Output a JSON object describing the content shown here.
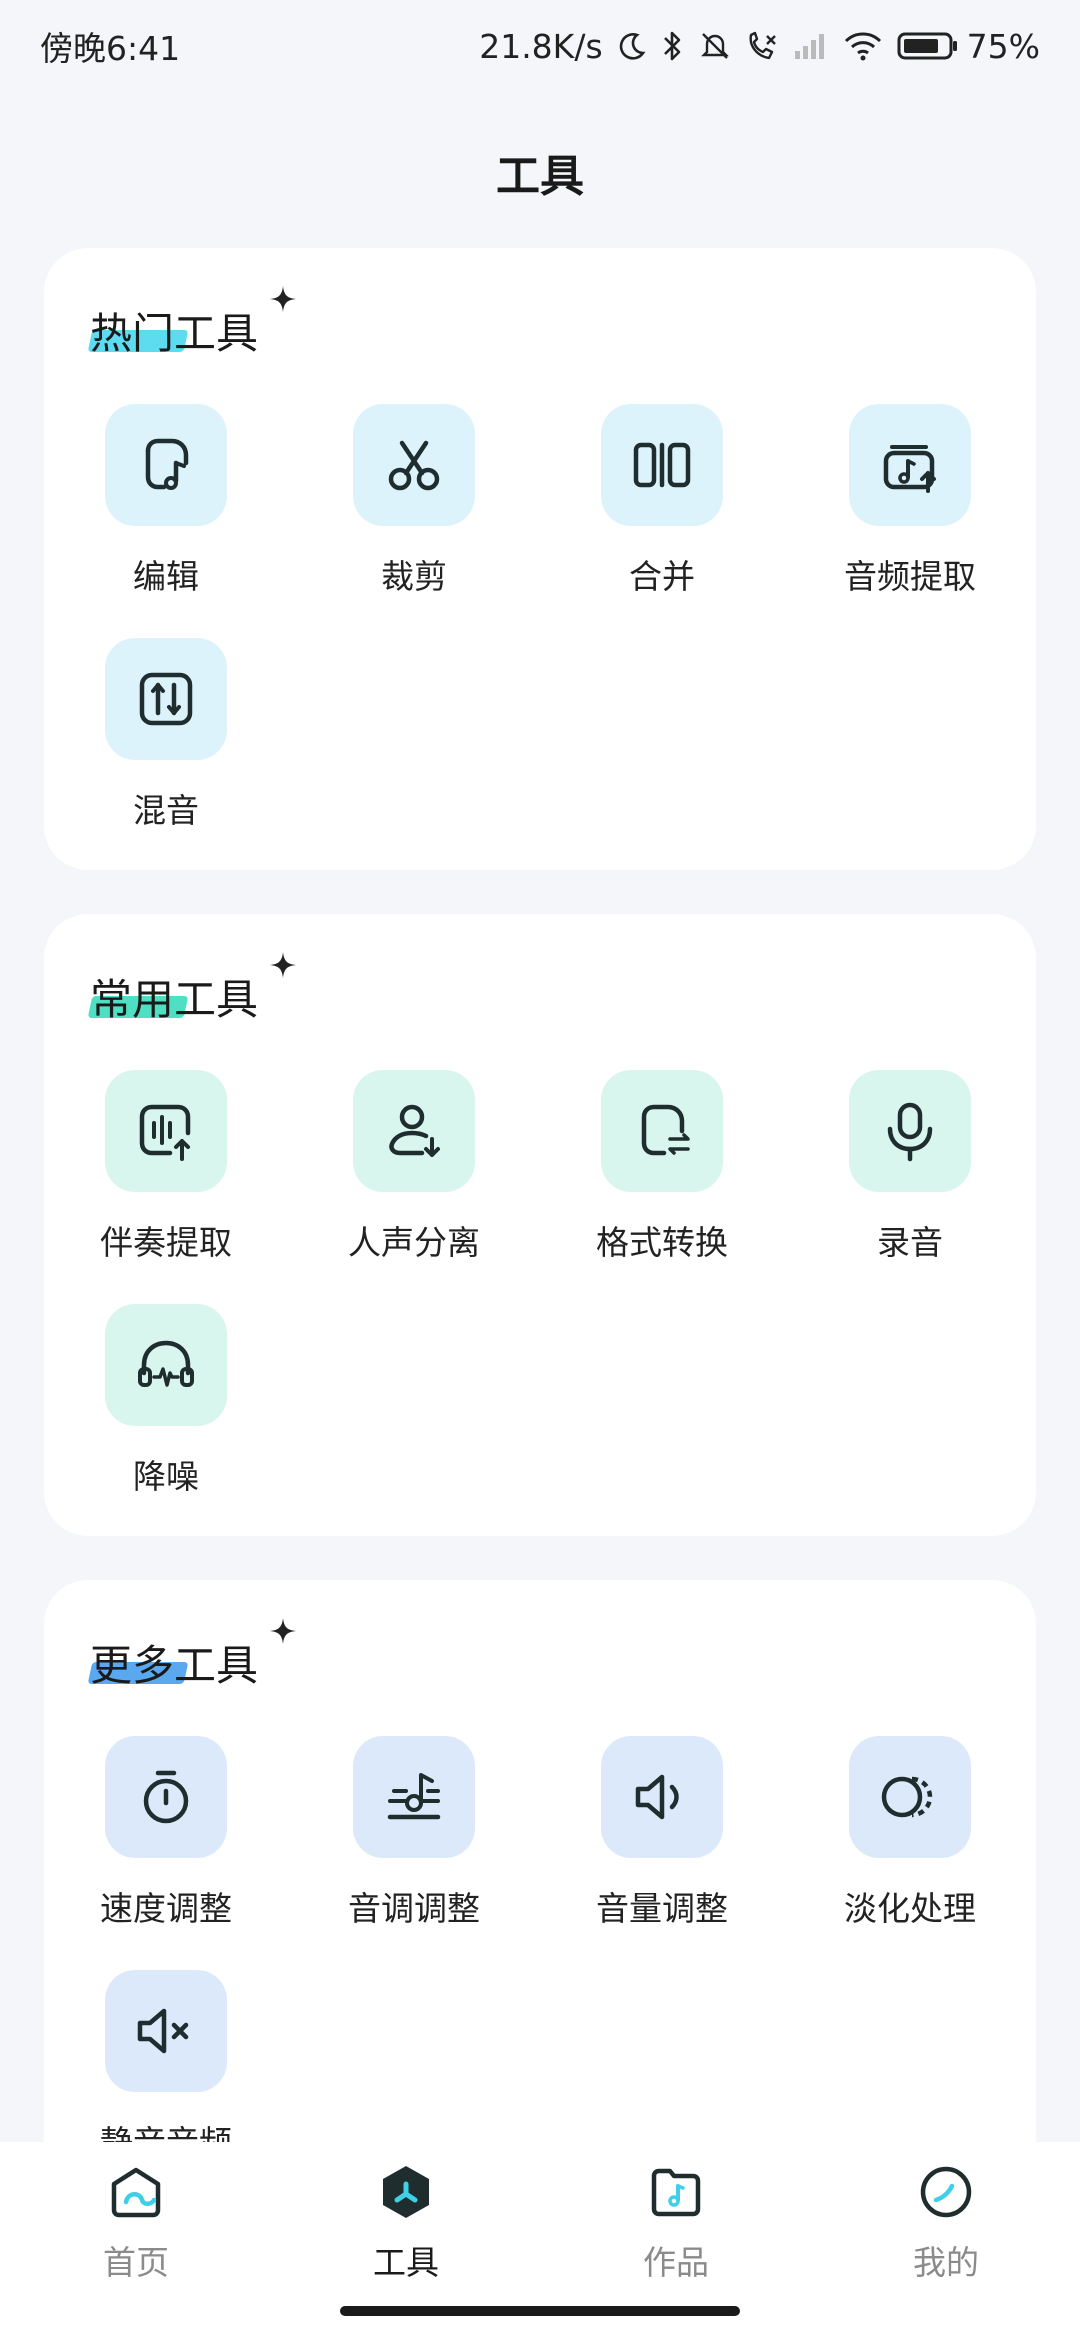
{
  "status_bar": {
    "time": "傍晚6:41",
    "network_speed": "21.8K/s",
    "battery_percent": "75%",
    "icons": [
      "moon-icon",
      "bluetooth-icon",
      "mute-bell-icon",
      "call-forward-icon",
      "signal-icon",
      "wifi-icon",
      "battery-icon"
    ]
  },
  "page": {
    "title": "工具"
  },
  "sections": [
    {
      "title": "热门工具",
      "highlight_color": "#5ddcf0",
      "tools": [
        {
          "label": "编辑",
          "icon": "edit-audio-icon"
        },
        {
          "label": "裁剪",
          "icon": "scissors-icon"
        },
        {
          "label": "合并",
          "icon": "merge-icon"
        },
        {
          "label": "音频提取",
          "icon": "audio-extract-icon"
        },
        {
          "label": "混音",
          "icon": "mixer-icon"
        }
      ]
    },
    {
      "title": "常用工具",
      "highlight_color": "#4fe0c4",
      "tools": [
        {
          "label": "伴奏提取",
          "icon": "accompaniment-extract-icon"
        },
        {
          "label": "人声分离",
          "icon": "vocal-separate-icon"
        },
        {
          "label": "格式转换",
          "icon": "format-convert-icon"
        },
        {
          "label": "录音",
          "icon": "microphone-icon"
        },
        {
          "label": "降噪",
          "icon": "headphones-icon"
        }
      ]
    },
    {
      "title": "更多工具",
      "highlight_color": "#5aa8f0",
      "tools": [
        {
          "label": "速度调整",
          "icon": "stopwatch-icon"
        },
        {
          "label": "音调调整",
          "icon": "pitch-icon"
        },
        {
          "label": "音量调整",
          "icon": "volume-icon"
        },
        {
          "label": "淡化处理",
          "icon": "fade-icon"
        },
        {
          "label": "静音音频",
          "icon": "mute-speaker-icon"
        }
      ]
    }
  ],
  "bottom_nav": [
    {
      "label": "首页",
      "icon": "home-icon",
      "active": false
    },
    {
      "label": "工具",
      "icon": "tools-icon",
      "active": true
    },
    {
      "label": "作品",
      "icon": "works-folder-icon",
      "active": false
    },
    {
      "label": "我的",
      "icon": "profile-icon",
      "active": false
    }
  ],
  "colors": {
    "accent": "#3fd0e8",
    "icon_stroke": "#1f2d2f",
    "background": "#f4f6fa"
  }
}
